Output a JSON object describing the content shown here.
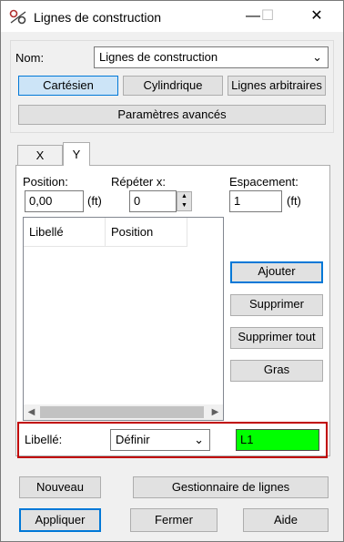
{
  "window": {
    "title": "Lignes de construction",
    "controls": {
      "minimize": "—",
      "maximize": "☐",
      "close": "✕"
    }
  },
  "name_row": {
    "label": "Nom:",
    "value": "Lignes de construction"
  },
  "type_buttons": {
    "cartesian": "Cartésien",
    "cylindrical": "Cylindrique",
    "arbitrary": "Lignes arbitraires",
    "selected": "cartesian"
  },
  "advanced_button": "Paramètres avancés",
  "tabs": {
    "x": "X",
    "y": "Y",
    "active": "y"
  },
  "grid": {
    "position_label": "Position:",
    "position_value": "0,00",
    "position_unit": "(ft)",
    "repeat_label": "Répéter x:",
    "repeat_value": "0",
    "spacing_label": "Espacement:",
    "spacing_value": "1",
    "spacing_unit": "(ft)",
    "columns": [
      "Libellé",
      "Position"
    ]
  },
  "list_actions": {
    "add": "Ajouter",
    "delete": "Supprimer",
    "delete_all": "Supprimer tout",
    "bold": "Gras"
  },
  "label_row": {
    "label": "Libellé:",
    "mode": "Définir",
    "value": "L1",
    "value_color": "#00ff00"
  },
  "bottom_buttons": {
    "new": "Nouveau",
    "manager": "Gestionnaire de lignes",
    "apply": "Appliquer",
    "close": "Fermer",
    "help": "Aide"
  },
  "colors": {
    "accent": "#0078d7",
    "highlight_border": "#c00000",
    "selected_bg": "#cce4f7"
  }
}
